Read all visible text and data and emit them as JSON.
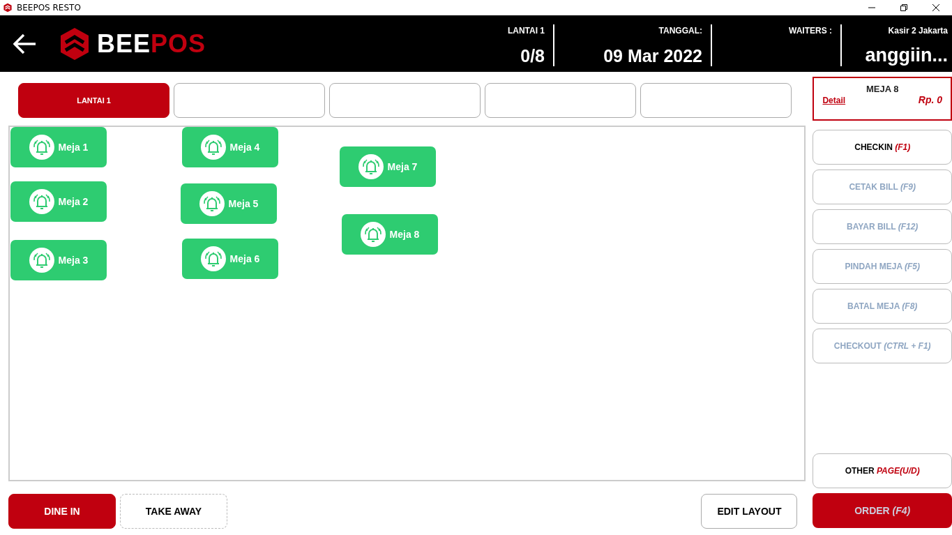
{
  "window": {
    "title": "BEEPOS RESTO"
  },
  "header": {
    "logo": {
      "part_1": "BEE",
      "part_2": "POS"
    },
    "stats": [
      {
        "label": "LANTAI 1",
        "value": "0/8"
      },
      {
        "label": "TANGGAL:",
        "value": "09 Mar 2022"
      },
      {
        "label": "WAITERS :"
      },
      {
        "label": "Kasir 2 Jakarta",
        "value": "anggiin..."
      }
    ]
  },
  "floor_tabs": [
    {
      "label": "LANTAI 1",
      "selected": true
    },
    {
      "selected": false
    },
    {
      "selected": false
    },
    {
      "selected": false
    },
    {
      "selected": false
    }
  ],
  "tables": [
    {
      "name": "Meja 1"
    },
    {
      "name": "Meja 2"
    },
    {
      "name": "Meja 3"
    },
    {
      "name": "Meja 4"
    },
    {
      "name": "Meja 5"
    },
    {
      "name": "Meja 6"
    },
    {
      "name": "Meja 7"
    },
    {
      "name": "Meja 8"
    }
  ],
  "order_modes": [
    {
      "label": "DINE IN",
      "selected": true
    },
    {
      "label": "TAKE AWAY",
      "selected": false
    }
  ],
  "edit_layout_button": "EDIT LAYOUT",
  "selected_table": {
    "name": "MEJA 8",
    "detail_link": "Detail",
    "total": "Rp. 0"
  },
  "actions": [
    {
      "label": "CHECKIN",
      "hotkey": "(F1)",
      "disabled": false
    },
    {
      "label": "CETAK BILL",
      "hotkey": "(F9)",
      "disabled": true
    },
    {
      "label": "BAYAR BILL",
      "hotkey": "(F12)",
      "disabled": true
    },
    {
      "label": "PINDAH MEJA",
      "hotkey": "(F5)",
      "disabled": true
    },
    {
      "label": "BATAL MEJA",
      "hotkey": "(F8)",
      "disabled": true
    },
    {
      "label": "CHECKOUT",
      "hotkey": "(CTRL + F1)",
      "disabled": true
    }
  ],
  "other_page_button": {
    "label": "OTHER",
    "hotkey": "PAGE(U/D)"
  },
  "order_button": {
    "label": "ORDER",
    "hotkey": "(F4)"
  }
}
